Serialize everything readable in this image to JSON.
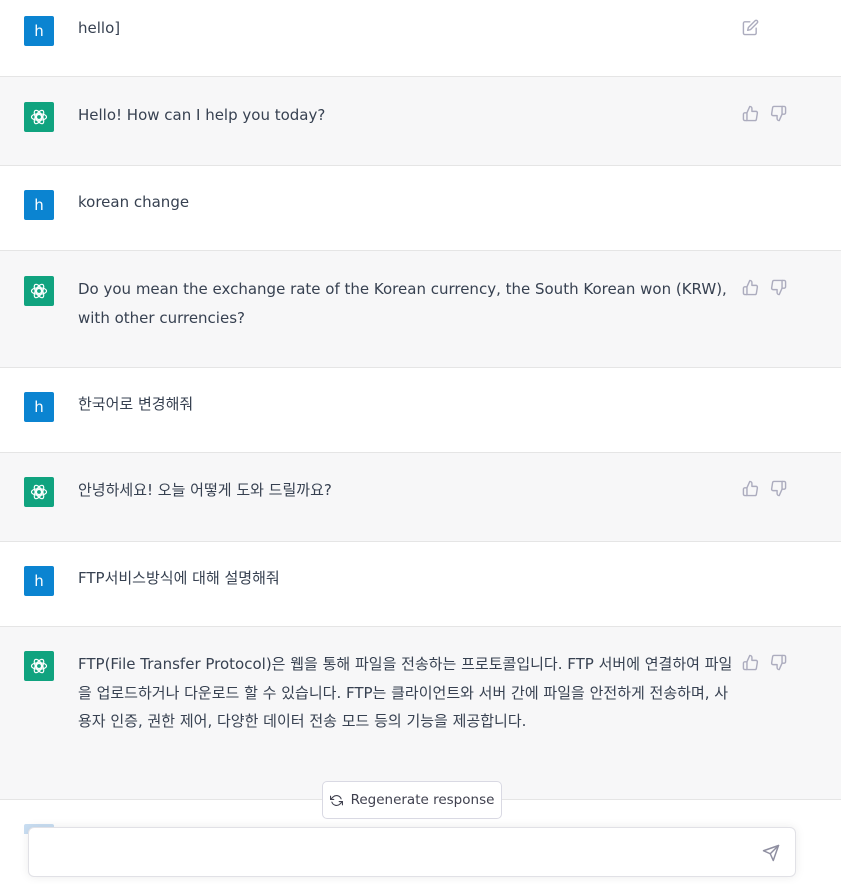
{
  "messages": [
    {
      "role": "user",
      "avatar_letter": "h",
      "text": "hello]",
      "action": "edit-icon"
    },
    {
      "role": "assistant",
      "text": "Hello! How can I help you today?",
      "actions": [
        "thumbs-up-icon",
        "thumbs-down-icon"
      ]
    },
    {
      "role": "user",
      "avatar_letter": "h",
      "text": "korean change"
    },
    {
      "role": "assistant",
      "text": "Do you mean the exchange rate of the Korean currency, the South Korean won (KRW), with other currencies?",
      "actions": [
        "thumbs-up-icon",
        "thumbs-down-icon"
      ]
    },
    {
      "role": "user",
      "avatar_letter": "h",
      "text": "한국어로 변경해줘"
    },
    {
      "role": "assistant",
      "text": "안녕하세요! 오늘 어떻게 도와 드릴까요?",
      "actions": [
        "thumbs-up-icon",
        "thumbs-down-icon"
      ]
    },
    {
      "role": "user",
      "avatar_letter": "h",
      "text": "FTP서비스방식에 대해 설명해줘"
    },
    {
      "role": "assistant",
      "text": "FTP(File Transfer Protocol)은 웹을 통해 파일을 전송하는 프로토콜입니다. FTP 서버에 연결하여 파일을 업로드하거나 다운로드 할 수 있습니다. FTP는 클라이언트와 서버 간에 파일을 안전하게 전송하며, 사용자 인증, 권한 제어, 다양한 데이터 전송 모드 등의 기능을 제공합니다.",
      "actions": [
        "thumbs-up-icon",
        "thumbs-down-icon"
      ]
    }
  ],
  "regenerate_label": "Regenerate response",
  "composer": {
    "value": "",
    "send_icon": "send-icon"
  },
  "colors": {
    "user_avatar": "#0b84d1",
    "assistant_avatar": "#10a37f",
    "assistant_bg": "#f7f7f8"
  }
}
